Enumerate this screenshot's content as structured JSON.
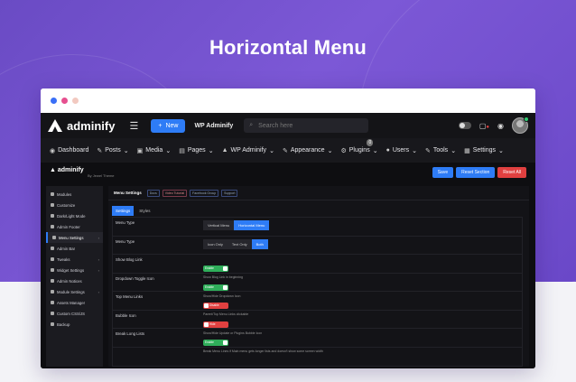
{
  "hero": {
    "title": "Horizontal Menu"
  },
  "window": {
    "dots": [
      "#3a6ff7",
      "#e64f8f",
      "#f2c9c0"
    ]
  },
  "adminbar": {
    "brand": "adminify",
    "new_label": "New",
    "site_name": "WP Adminify",
    "search_placeholder": "Search here"
  },
  "menu": {
    "items": [
      {
        "label": "Dashboard",
        "icon": "gauge-icon",
        "glyph": "◉"
      },
      {
        "label": "Posts",
        "icon": "pin-icon",
        "glyph": "✎"
      },
      {
        "label": "Media",
        "icon": "media-icon",
        "glyph": "▣"
      },
      {
        "label": "Pages",
        "icon": "page-icon",
        "glyph": "▤"
      },
      {
        "label": "WP Adminify",
        "icon": "adminify-icon",
        "glyph": "▲"
      },
      {
        "label": "Appearance",
        "icon": "brush-icon",
        "glyph": "✎"
      },
      {
        "label": "Plugins",
        "icon": "plug-icon",
        "glyph": "⚙",
        "badge": "0"
      },
      {
        "label": "Users",
        "icon": "users-icon",
        "glyph": "●"
      },
      {
        "label": "Tools",
        "icon": "wrench-icon",
        "glyph": "✎"
      },
      {
        "label": "Settings",
        "icon": "settings-icon",
        "glyph": "▦"
      }
    ]
  },
  "content_header": {
    "brand": "adminify",
    "byline": "By Jewel Theme",
    "save": "Save",
    "reset_section": "Reset Section",
    "reset_all": "Reset All",
    "save_color": "#2e7cf6",
    "reset_section_color": "#2e7cf6",
    "reset_all_color": "#e04040"
  },
  "sidebar": {
    "items": [
      {
        "label": "Modules",
        "arrow": ""
      },
      {
        "label": "Customize",
        "arrow": ""
      },
      {
        "label": "Dark/Light Mode",
        "arrow": ""
      },
      {
        "label": "Admin Footer",
        "arrow": ""
      },
      {
        "label": "Menu Settings",
        "arrow": "›",
        "active": true
      },
      {
        "label": "Admin Bar",
        "arrow": ""
      },
      {
        "label": "Tweaks",
        "arrow": "›"
      },
      {
        "label": "Widget Settings",
        "arrow": "›"
      },
      {
        "label": "Admin Notices",
        "arrow": ""
      },
      {
        "label": "Module Settings",
        "arrow": "›"
      },
      {
        "label": "Assets Manager",
        "arrow": ""
      },
      {
        "label": "Custom CSS/JS",
        "arrow": ""
      },
      {
        "label": "Backup",
        "arrow": ""
      }
    ]
  },
  "main": {
    "title": "Menu Settings",
    "chips": [
      "Docs",
      "Video Tutorial",
      "Facebook Group",
      "Support"
    ],
    "tabs": [
      "Settings",
      "Styles"
    ],
    "rows": [
      {
        "label": "Menu Type",
        "type": "segment",
        "options": [
          "Vertical Menu",
          "Horizontal Menu"
        ],
        "selected": 1
      },
      {
        "label": "Menu Type",
        "type": "segment",
        "options": [
          "Icon Only",
          "Text Only",
          "Both"
        ],
        "selected": 2
      },
      {
        "label": "Show Blog Link",
        "type": "switch",
        "state": "Enable",
        "on": true,
        "hint": "Show Blog Link in beginning"
      },
      {
        "label": "Dropdown Toggle Icon",
        "type": "switch",
        "state": "Enable",
        "on": true,
        "hint": "Show/Hide Dropdown Icon"
      },
      {
        "label": "Top Menu Links",
        "type": "switch",
        "state": "Disable",
        "on": false,
        "hint": "Parent/Top Menu Links clickable"
      },
      {
        "label": "Bubble Icon",
        "type": "switch",
        "state": "Hide",
        "on": false,
        "hint": "Show/Hide Update or Plugins Bubble Icon"
      },
      {
        "label": "Break Long Lists",
        "type": "switch",
        "state": "Enable",
        "on": true,
        "hint": "Break Menu Lines if Main menu gets longer lists and doesn't show some screen width"
      }
    ]
  }
}
